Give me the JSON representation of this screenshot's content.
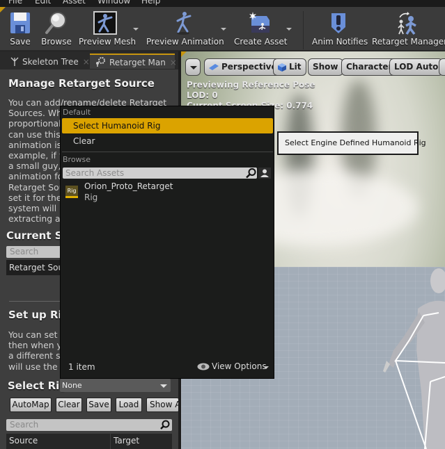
{
  "menubar": {
    "items": [
      "File",
      "Edit",
      "Asset",
      "Window",
      "Help"
    ]
  },
  "toolbar": {
    "buttons": [
      {
        "label": "Save",
        "icon": "floppy-disk-icon"
      },
      {
        "label": "Browse",
        "icon": "magnifier-icon"
      },
      {
        "label": "Preview Mesh",
        "icon": "preview-mesh-icon",
        "has_dropdown": true
      },
      {
        "label": "Preview Animation",
        "icon": "running-figure-icon",
        "has_dropdown": true
      },
      {
        "label": "Create Asset",
        "icon": "create-asset-icon",
        "has_dropdown": true
      },
      {
        "label": "Anim Notifies",
        "icon": "exclamation-shield-icon"
      },
      {
        "label": "Retarget Manager",
        "icon": "retarget-figures-icon"
      }
    ]
  },
  "tabs": [
    {
      "label": "Skeleton Tree",
      "icon": "skeleton-tree-icon",
      "active": false
    },
    {
      "label": "Retarget Man",
      "icon": "gear-figure-icon",
      "active": true
    }
  ],
  "left_panel": {
    "manage_title": "Manage Retarget Source",
    "manage_text": "You can add/rename/delete Retarget\nSources. Whe\nproportional \ncan use this \nanimation is f\nexample, if y\na small guy, a\nanimation for\nRetarget Sou\nset it for the a\nsystem will u\nextracting an",
    "current_title": "Current Sk",
    "search_placeholder": "Search",
    "retarget_source_row": "Retarget Sour",
    "setup_title": "Set up Rig",
    "setup_text": "You can set u\nthen when yo\na different sk\nwill use the in",
    "select_rig_label": "Select Rig",
    "select_rig_value": "None",
    "buttons": [
      "AutoMap",
      "Clear",
      "Save",
      "Load",
      "Show A"
    ],
    "table_search_placeholder": "Search",
    "columns": [
      "Source",
      "Target"
    ]
  },
  "viewport": {
    "toolbar": [
      "Perspective",
      "Lit",
      "Show",
      "Character",
      "LOD Auto"
    ],
    "info_lines": [
      "Previewing Reference Pose",
      "LOD: 0",
      "Current Screen Size: 0.774"
    ]
  },
  "popup": {
    "default_header": "Default",
    "items": [
      "Select Humanoid Rig",
      "Clear"
    ],
    "highlighted_index": 0,
    "browse_header": "Browse",
    "search_placeholder": "Search Assets",
    "assets": [
      {
        "name": "Orion_Proto_Retarget",
        "type": "Rig",
        "thumb_label": "Rig"
      }
    ],
    "item_count": "1 item",
    "view_options": "View Options"
  },
  "tooltip": {
    "text": "Select Engine Defined Humanoid Rig"
  },
  "colors": {
    "accent": "#dba300",
    "panel_bg": "#3e3e3e",
    "popup_bg": "#1b1c1b"
  }
}
